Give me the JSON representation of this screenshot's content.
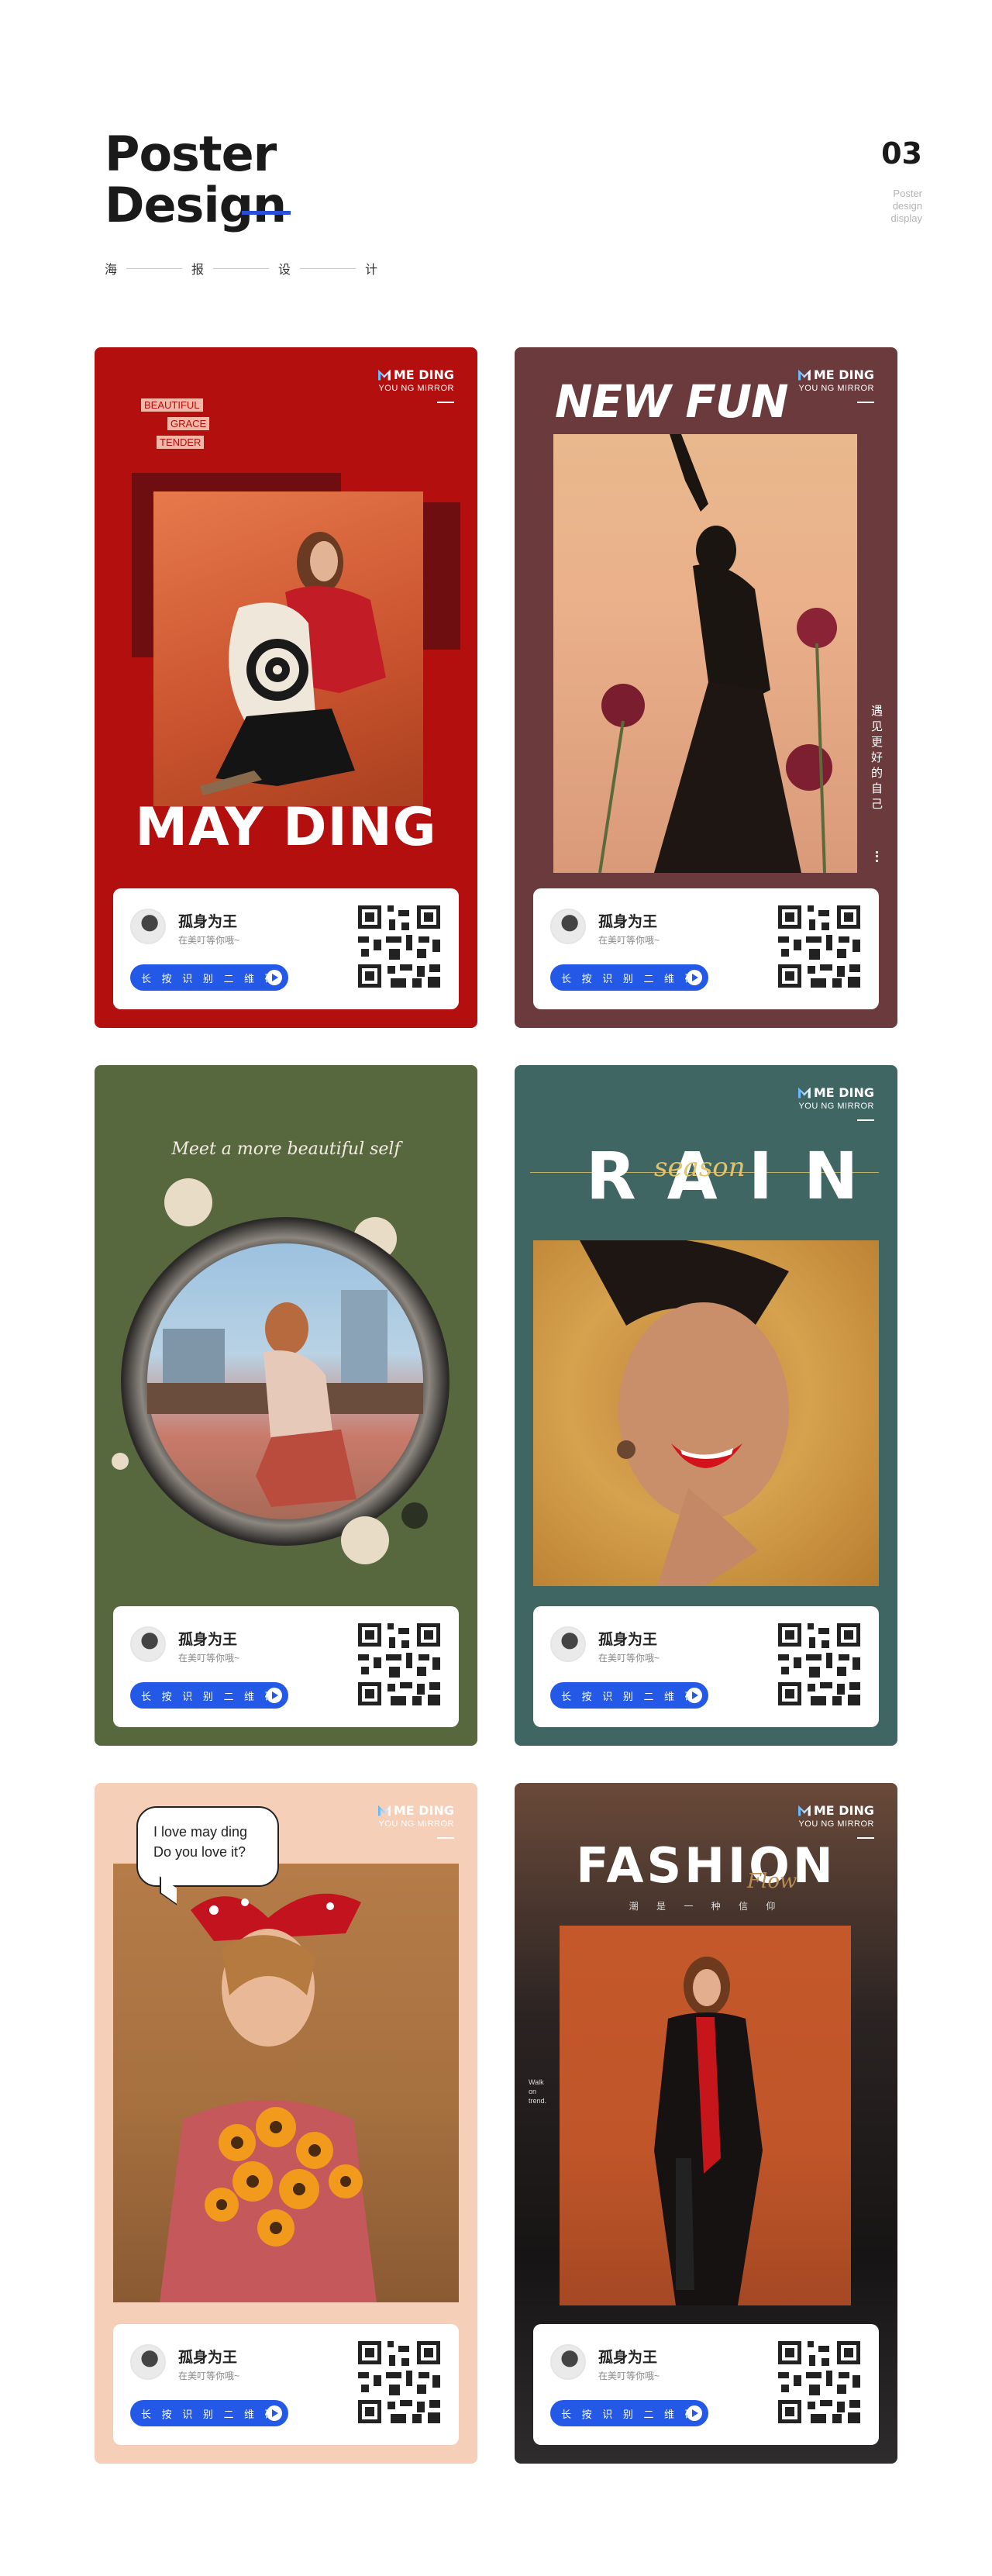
{
  "header": {
    "title_line1": "Poster",
    "title_line2": "Design",
    "subtitle_chars": [
      "海",
      "报",
      "设",
      "计"
    ],
    "number": "03",
    "number_sub": [
      "Poster",
      "design",
      "display"
    ]
  },
  "brand": {
    "name": "ME DING",
    "tagline": "YOU NG MIRROR"
  },
  "contact": {
    "name": "孤身为王",
    "tagline": "在美叮等你哦~",
    "scan_label": "长 按 识 别 二 维 码"
  },
  "posters": [
    {
      "title": "MAY DING",
      "tags": [
        "BEAUTIFUL",
        "GRACE",
        "TENDER"
      ]
    },
    {
      "title": "NEW FUN",
      "vertical_text": "遇见更好的自己"
    },
    {
      "script": "Meet a more beautiful self"
    },
    {
      "title": "RAIN",
      "script": "season"
    },
    {
      "bubble_line1": "I love may ding",
      "bubble_line2": "Do you love it?"
    },
    {
      "title": "FASHION",
      "script": "Flow",
      "subtitle": "潮 是 一 种 信 仰",
      "side_text": [
        "Walk",
        "on",
        "trend."
      ]
    }
  ],
  "colors": {
    "accent_blue": "#2458e6",
    "poster1_bg": "#b30f0f",
    "poster2_bg": "#6b3a3c",
    "poster3_bg": "#58683e",
    "poster4_bg": "#3f6663",
    "poster5_bg": "#f6cfb9"
  }
}
